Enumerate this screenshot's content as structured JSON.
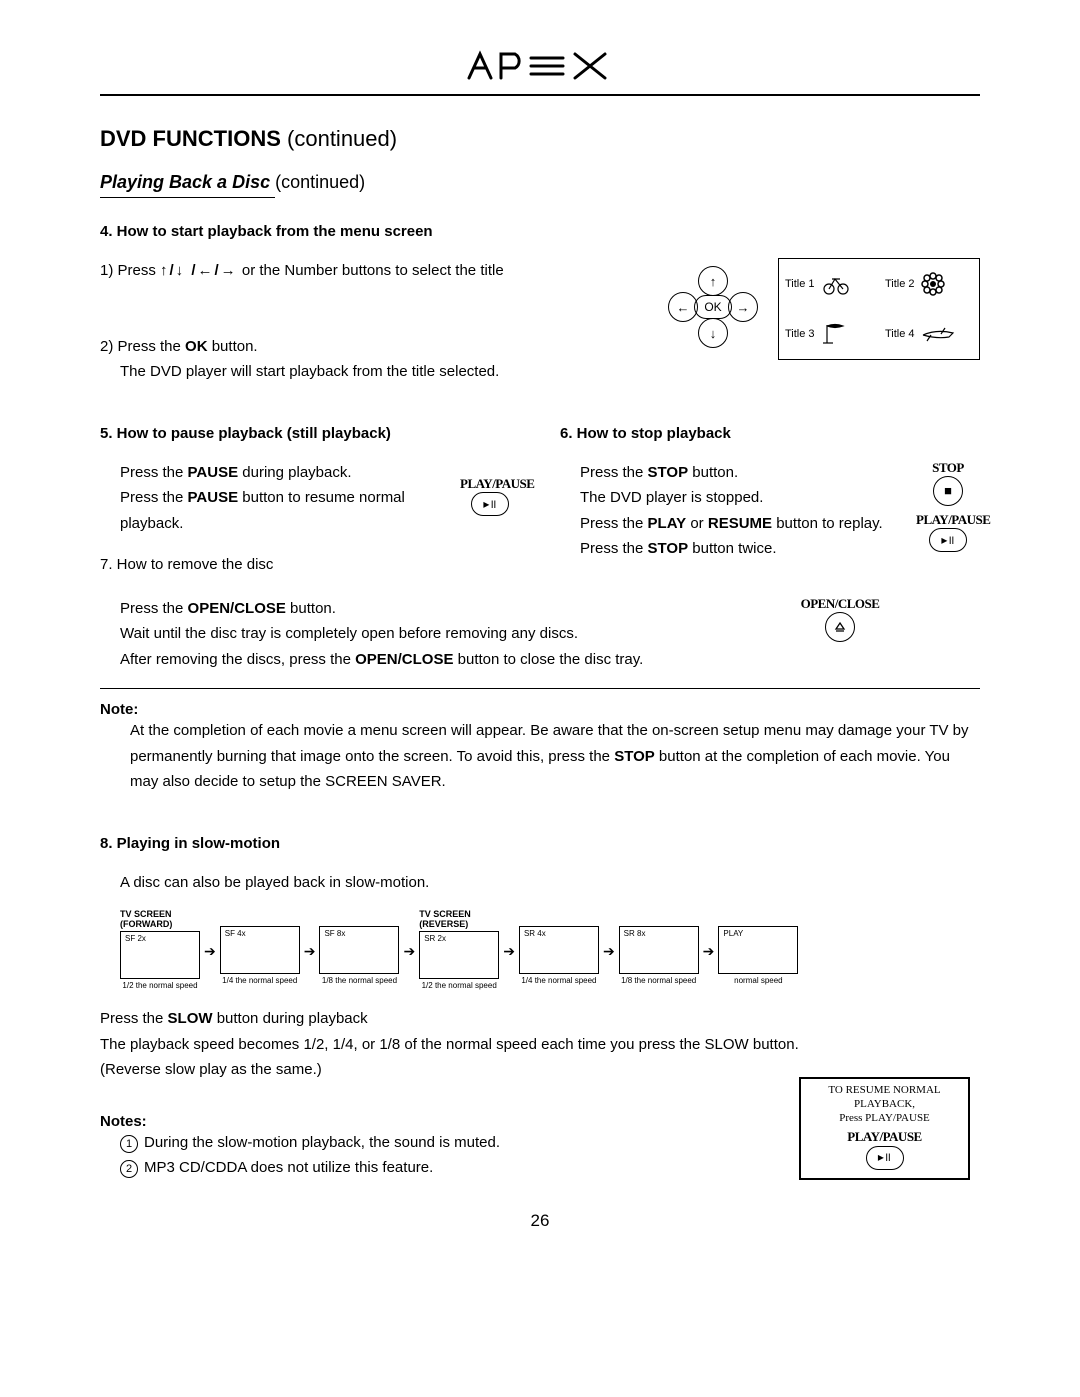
{
  "brand": "APEX",
  "sectionTitle": {
    "bold": "DVD FUNCTIONS",
    "cont": "(continued)"
  },
  "subsection": {
    "title": "Playing Back a Disc",
    "cont": "(continued)"
  },
  "step4": {
    "heading": "4. How to start playback from the menu screen",
    "line1a": "1) Press ",
    "line1b": " or the Number buttons to select the title",
    "line2a": "2) Press the ",
    "line2ok": "OK",
    "line2b": " button.",
    "line3": "The DVD player will start playback from the title selected."
  },
  "dpad": {
    "ok": "OK"
  },
  "menuIllus": {
    "t1": "Title 1",
    "t2": "Title 2",
    "t3": "Title 3",
    "t4": "Title 4"
  },
  "step5": {
    "heading": "5. How to pause playback (still playback)",
    "p1a": "Press the ",
    "p1b": "PAUSE",
    "p1c": " during playback.",
    "p2a": "Press the ",
    "p2b": "PAUSE",
    "p2c": " button to resume normal playback."
  },
  "step6": {
    "heading": "6. How to stop playback",
    "l1a": "Press the ",
    "l1b": "STOP",
    "l1c": " button.",
    "l2": "The DVD player is stopped.",
    "l3a": "Press the ",
    "l3b": "PLAY",
    "l3c": " or ",
    "l3d": "RESUME",
    "l3e": " button to replay.",
    "l4a": "Press the ",
    "l4b": "STOP",
    "l4c": " button twice."
  },
  "step7": {
    "heading": "7. How to remove the disc",
    "l1a": "Press the ",
    "l1b": "OPEN/CLOSE",
    "l1c": " button.",
    "l2": "Wait until the disc tray is completely open before removing any discs.",
    "l3a": "After removing the discs, press the ",
    "l3b": "OPEN/CLOSE",
    "l3c": " button to close the disc tray."
  },
  "icons": {
    "playpause": "PLAY/PAUSE",
    "stop": "STOP",
    "openclose": "OPEN/CLOSE"
  },
  "note1": {
    "title": "Note:",
    "body": "At  the completion of each movie a menu screen will appear. Be aware that the on-screen setup menu may damage your TV by permanently burning that image onto the screen. To avoid this, press the ",
    "stop": "STOP",
    "body2": " button at the completion of each movie. You may also decide to setup the SCREEN SAVER."
  },
  "step8": {
    "heading": "8. Playing in slow-motion",
    "intro": "A disc can also be played back in slow-motion.",
    "fwdLabel": "TV SCREEN (FORWARD)",
    "revLabel": "TV SCREEN (REVERSE)",
    "boxes": [
      {
        "tag": "SF 2x",
        "cap": "1/2 the normal speed"
      },
      {
        "tag": "SF 4x",
        "cap": "1/4 the normal speed"
      },
      {
        "tag": "SF 8x",
        "cap": "1/8 the normal speed"
      },
      {
        "tag": "SR 2x",
        "cap": "1/2 the normal speed"
      },
      {
        "tag": "SR 4x",
        "cap": "1/4 the normal speed"
      },
      {
        "tag": "SR 8x",
        "cap": "1/8 the normal speed"
      },
      {
        "tag": "PLAY",
        "cap": "normal speed"
      }
    ],
    "p1a": "Press the ",
    "p1b": "SLOW",
    "p1c": " button during playback",
    "p2": "The playback speed becomes 1/2, 1/4, or 1/8 of the normal speed each time you press the SLOW button.",
    "p3": "(Reverse slow play as the same.)"
  },
  "resumeBox": {
    "l1": "TO RESUME NORMAL PLAYBACK,",
    "l2": "Press PLAY/PAUSE",
    "label": "PLAY/PAUSE"
  },
  "notes2": {
    "title": "Notes:",
    "n1": "During the slow-motion playback, the sound is muted.",
    "n2": "MP3 CD/CDDA does not utilize this feature."
  },
  "pageNumber": "26"
}
